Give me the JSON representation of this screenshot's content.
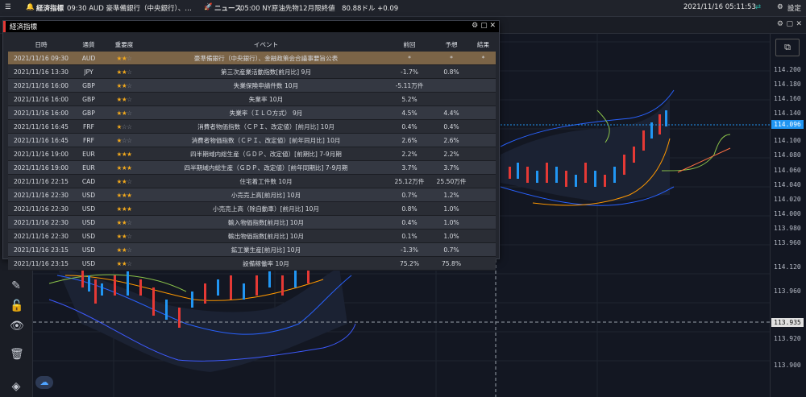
{
  "topbar": {
    "menu_icon": "hamburger-icon",
    "alert_title": "経済指標",
    "alert_text": "09:30 AUD 豪準備銀行（中央銀行）、…",
    "news_label": "ニュース",
    "news_text": "05:00 NY原油先物12月限終値　80.88ドル +0.09",
    "datetime": "2021/11/16 05:11:53",
    "settings_label": "設定"
  },
  "panel": {
    "title": "経済指標",
    "columns": [
      "日時",
      "通貨",
      "重要度",
      "イベント",
      "前回",
      "予想",
      "結果"
    ],
    "rows": [
      {
        "date": "2021/11/16 09:30",
        "cur": "AUD",
        "stars": 2,
        "event": "豪準備銀行（中央銀行）、金融政策会合議事要旨公表",
        "prev": "*",
        "fc": "*",
        "res": "*"
      },
      {
        "date": "2021/11/16 13:30",
        "cur": "JPY",
        "stars": 2,
        "event": "第三次産業活動指数[前月比] 9月",
        "prev": "-1.7%",
        "fc": "0.8%",
        "res": ""
      },
      {
        "date": "2021/11/16 16:00",
        "cur": "GBP",
        "stars": 2,
        "event": "失業保険申請件数 10月",
        "prev": "-5.11万件",
        "fc": "",
        "res": ""
      },
      {
        "date": "2021/11/16 16:00",
        "cur": "GBP",
        "stars": 2,
        "event": "失業率 10月",
        "prev": "5.2%",
        "fc": "",
        "res": ""
      },
      {
        "date": "2021/11/16 16:00",
        "cur": "GBP",
        "stars": 2,
        "event": "失業率（ＩＬＯ方式） 9月",
        "prev": "4.5%",
        "fc": "4.4%",
        "res": ""
      },
      {
        "date": "2021/11/16 16:45",
        "cur": "FRF",
        "stars": 1,
        "event": "消費者物価指数（ＣＰＩ、改定値）[前月比] 10月",
        "prev": "0.4%",
        "fc": "0.4%",
        "res": ""
      },
      {
        "date": "2021/11/16 16:45",
        "cur": "FRF",
        "stars": 1,
        "event": "消費者物価指数（ＣＰＩ、改定値）[前年同月比] 10月",
        "prev": "2.6%",
        "fc": "2.6%",
        "res": ""
      },
      {
        "date": "2021/11/16 19:00",
        "cur": "EUR",
        "stars": 3,
        "event": "四半期域内総生産（ＧＤＰ、改定値）[前期比] 7-9月期",
        "prev": "2.2%",
        "fc": "2.2%",
        "res": ""
      },
      {
        "date": "2021/11/16 19:00",
        "cur": "EUR",
        "stars": 3,
        "event": "四半期域内総生産（ＧＤＰ、改定値）[前年同期比] 7-9月期",
        "prev": "3.7%",
        "fc": "3.7%",
        "res": ""
      },
      {
        "date": "2021/11/16 22:15",
        "cur": "CAD",
        "stars": 2,
        "event": "住宅着工件数 10月",
        "prev": "25.12万件",
        "fc": "25.50万件",
        "res": ""
      },
      {
        "date": "2021/11/16 22:30",
        "cur": "USD",
        "stars": 3,
        "event": "小売売上高[前月比] 10月",
        "prev": "0.7%",
        "fc": "1.2%",
        "res": ""
      },
      {
        "date": "2021/11/16 22:30",
        "cur": "USD",
        "stars": 3,
        "event": "小売売上高（除自動車）[前月比] 10月",
        "prev": "0.8%",
        "fc": "1.0%",
        "res": ""
      },
      {
        "date": "2021/11/16 22:30",
        "cur": "USD",
        "stars": 2,
        "event": "輸入物価指数[前月比] 10月",
        "prev": "0.4%",
        "fc": "1.0%",
        "res": ""
      },
      {
        "date": "2021/11/16 22:30",
        "cur": "USD",
        "stars": 2,
        "event": "輸出物価指数[前月比] 10月",
        "prev": "0.1%",
        "fc": "1.0%",
        "res": ""
      },
      {
        "date": "2021/11/16 23:15",
        "cur": "USD",
        "stars": 2,
        "event": "鉱工業生産[前月比] 10月",
        "prev": "-1.3%",
        "fc": "0.7%",
        "res": ""
      },
      {
        "date": "2021/11/16 23:15",
        "cur": "USD",
        "stars": 2,
        "event": "設備稼働率 10月",
        "prev": "75.2%",
        "fc": "75.8%",
        "res": ""
      }
    ]
  },
  "axis": {
    "labels": [
      "114.200",
      "114.180",
      "114.160",
      "114.140",
      "114.120",
      "114.100",
      "114.080",
      "114.060",
      "114.040",
      "114.020",
      "114.000",
      "113.980",
      "113.960",
      "113.920",
      "113.900"
    ],
    "current_price": "114.096",
    "crosshair_price": "113.935"
  },
  "chart": {
    "up_color": "#2196f3",
    "down_color": "#e53935",
    "band_color": "#2962ff",
    "ma_orange": "#ff9800",
    "ma_green": "#8bc34a"
  },
  "tools": [
    "magnet-icon",
    "pencil-icon",
    "lock-icon",
    "eye-icon",
    "trash-icon",
    "layers-icon"
  ]
}
